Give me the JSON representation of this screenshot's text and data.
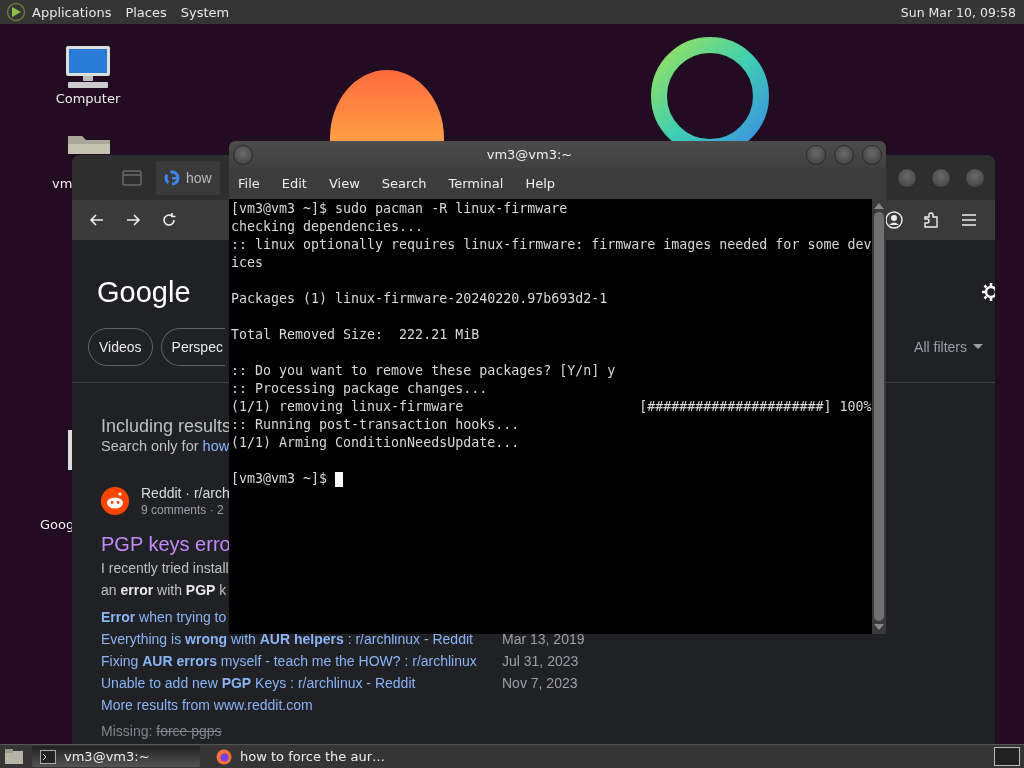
{
  "top_panel": {
    "menus": [
      "Applications",
      "Places",
      "System"
    ],
    "clock": "Sun Mar 10, 09:58"
  },
  "desktop_icons": [
    {
      "label": "Computer",
      "kind": "computer"
    },
    {
      "label": "vm",
      "kind": "folder"
    },
    {
      "label": "Goog",
      "kind": "file"
    }
  ],
  "browser": {
    "tab_title": "how",
    "logo": "Google",
    "chips": [
      "Videos",
      "Perspec"
    ],
    "all_filters": "All filters",
    "including": "Including results",
    "search_only": "Search only for",
    "search_only_link": "how",
    "result": {
      "source": "Reddit · r/arch",
      "meta": "9 comments · 2",
      "title": "PGP keys erro",
      "snippet": [
        "I recently tried install",
        "an **error** with **PGP** k"
      ],
      "sitelinks": [
        {
          "text": "**Error** when trying to"
        },
        {
          "text": "Everything is **wrong** with **AUR helpers** : r/archlinux - Reddit",
          "date": "Mar 13, 2019"
        },
        {
          "text": "Fixing **AUR errors** myself - teach me the HOW? : r/archlinux",
          "date": "Jul 31, 2023"
        },
        {
          "text": "Unable to add new **PGP** Keys : r/archlinux - Reddit",
          "date": "Nov 7, 2023"
        }
      ],
      "more": "More results from www.reddit.com",
      "missing_label": "Missing:",
      "missing_terms": "force pgps"
    }
  },
  "terminal": {
    "title": "vm3@vm3:~",
    "menus": [
      "File",
      "Edit",
      "View",
      "Search",
      "Terminal",
      "Help"
    ],
    "blocks": [
      [
        "[vm3@vm3 ~]$ sudo pacman -R linux-firmware",
        "checking dependencies...",
        ":: linux optionally requires linux-firmware: firmware images needed for some dev",
        "ices"
      ],
      [
        "Packages (1) linux-firmware-20240220.97b693d2-1"
      ],
      [
        "Total Removed Size:  222.21 MiB"
      ],
      [
        ":: Do you want to remove these packages? [Y/n] y",
        ":: Processing package changes...",
        "(1/1) removing linux-firmware                      [######################] 100%",
        ":: Running post-transaction hooks...",
        "(1/1) Arming ConditionNeedsUpdate..."
      ]
    ],
    "prompt": "[vm3@vm3 ~]$",
    "cursor": true
  },
  "taskbar": {
    "items": [
      {
        "label": "vm3@vm3:~",
        "kind": "terminal",
        "selected": true
      },
      {
        "label": "how to force the aur…",
        "kind": "browser",
        "selected": false
      }
    ]
  }
}
